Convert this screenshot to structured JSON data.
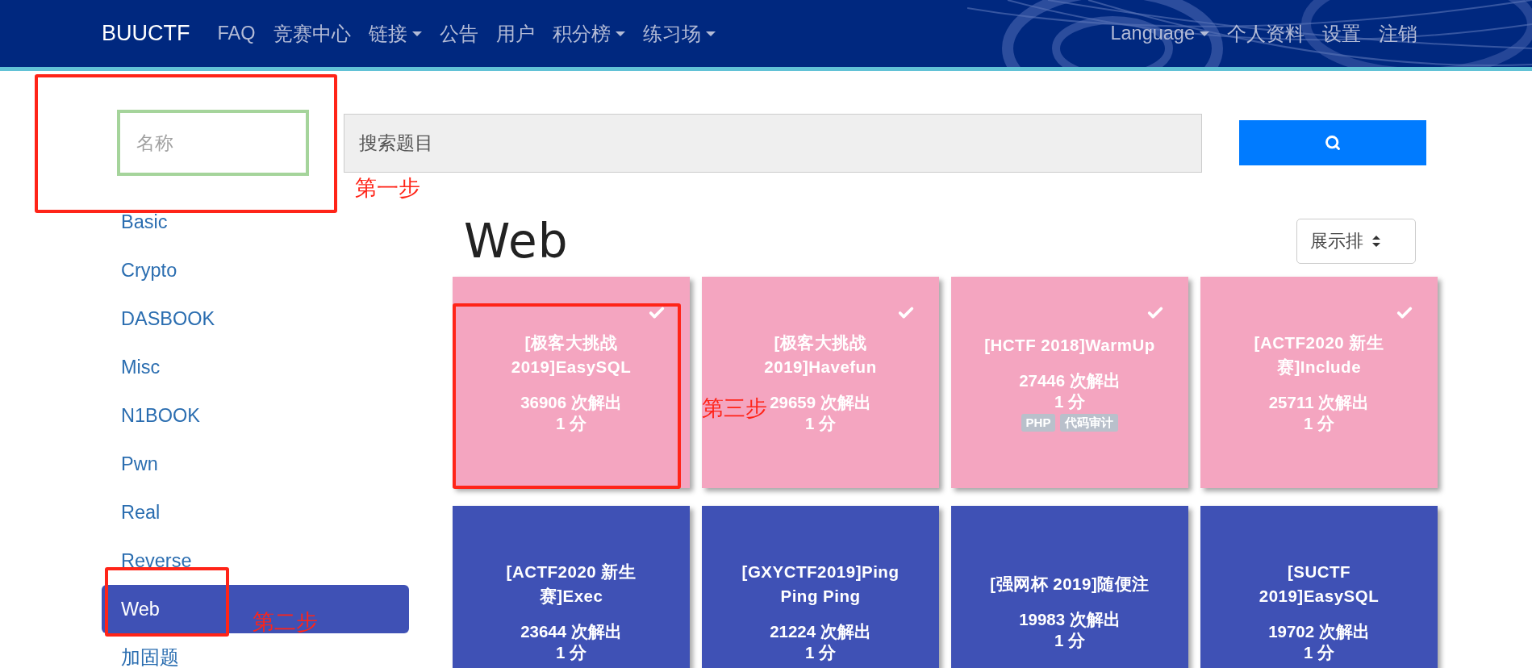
{
  "navbar": {
    "brand": "BUUCTF",
    "items": [
      {
        "label": "FAQ",
        "dropdown": false
      },
      {
        "label": "竞赛中心",
        "dropdown": false
      },
      {
        "label": "链接",
        "dropdown": true
      },
      {
        "label": "公告",
        "dropdown": false
      },
      {
        "label": "用户",
        "dropdown": false
      },
      {
        "label": "积分榜",
        "dropdown": true
      },
      {
        "label": "练习场",
        "dropdown": true
      }
    ],
    "right_items": [
      {
        "label": "Language",
        "dropdown": true
      },
      {
        "label": "个人资料",
        "dropdown": false
      },
      {
        "label": "设置",
        "dropdown": false
      },
      {
        "label": "注销",
        "dropdown": false
      }
    ]
  },
  "name_field": {
    "placeholder": "名称"
  },
  "search": {
    "placeholder": "搜索题目"
  },
  "sidebar": {
    "items": [
      {
        "label": "Basic",
        "selected": false
      },
      {
        "label": "Crypto",
        "selected": false
      },
      {
        "label": "DASBOOK",
        "selected": false
      },
      {
        "label": "Misc",
        "selected": false
      },
      {
        "label": "N1BOOK",
        "selected": false
      },
      {
        "label": "Pwn",
        "selected": false
      },
      {
        "label": "Real",
        "selected": false
      },
      {
        "label": "Reverse",
        "selected": false
      },
      {
        "label": "Web",
        "selected": true
      },
      {
        "label": "加固题",
        "selected": false
      }
    ]
  },
  "category_title": "Web",
  "sort_select": {
    "value": "展示排"
  },
  "challenges": [
    {
      "title": "[极客大挑战 2019]EasySQL",
      "solves": "36906 次解出",
      "points": "1 分",
      "solved": true
    },
    {
      "title": "[极客大挑战 2019]Havefun",
      "solves": "29659 次解出",
      "points": "1 分",
      "solved": true
    },
    {
      "title": "[HCTF 2018]WarmUp",
      "solves": "27446 次解出",
      "points": "1 分",
      "solved": true,
      "tags": [
        "PHP",
        "代码审计"
      ]
    },
    {
      "title": "[ACTF2020 新生赛]Include",
      "solves": "25711 次解出",
      "points": "1 分",
      "solved": true
    },
    {
      "title": "[ACTF2020 新生赛]Exec",
      "solves": "23644 次解出",
      "points": "1 分",
      "solved": false
    },
    {
      "title": "[GXYCTF2019]Ping Ping Ping",
      "solves": "21224 次解出",
      "points": "1 分",
      "solved": false
    },
    {
      "title": "[强网杯 2019]随便注",
      "solves": "19983 次解出",
      "points": "1 分",
      "solved": false
    },
    {
      "title": "[SUCTF 2019]EasySQL",
      "solves": "19702 次解出",
      "points": "1 分",
      "solved": false
    }
  ],
  "annotations": [
    {
      "text": "第一步"
    },
    {
      "text": "第二步"
    },
    {
      "text": "第三步"
    }
  ]
}
